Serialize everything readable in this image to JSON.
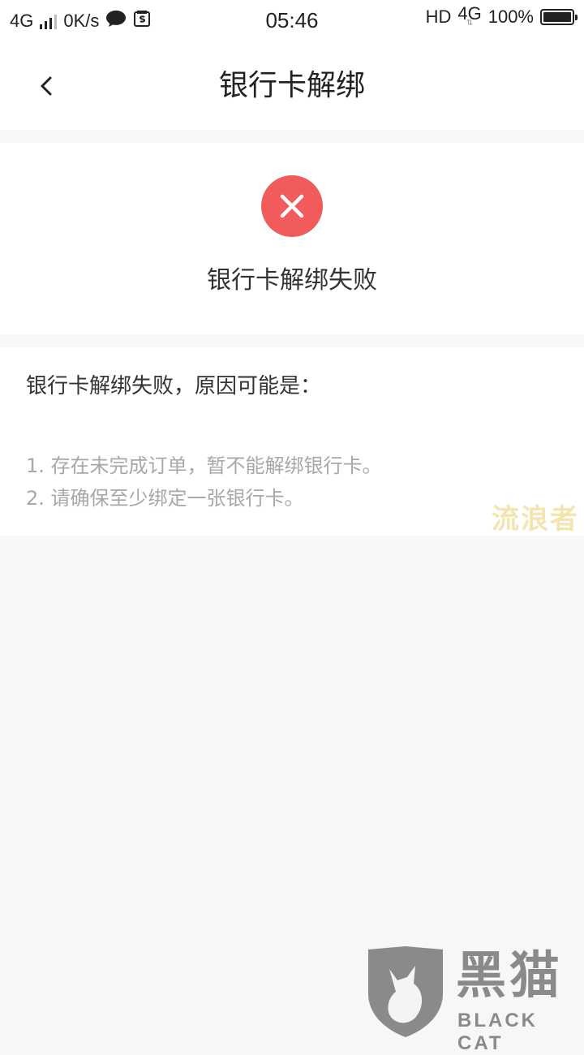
{
  "status_bar": {
    "network_left": "4G",
    "speed": "0K/s",
    "time": "05:46",
    "hd": "HD",
    "network_right": "4G",
    "battery": "100%",
    "battery_level": 1.0
  },
  "nav": {
    "title": "银行卡解绑"
  },
  "result": {
    "title": "银行卡解绑失败",
    "icon": "close-circle-icon",
    "icon_color": "#f25b5b"
  },
  "reasons": {
    "heading": "银行卡解绑失败，原因可能是：",
    "items": [
      "1. 存在未完成订单，暂不能解绑银行卡。",
      "2. 请确保至少绑定一张银行卡。"
    ]
  },
  "watermarks": {
    "text": "流浪者",
    "brand_cn": "黑猫",
    "brand_en": "BLACK CAT"
  }
}
